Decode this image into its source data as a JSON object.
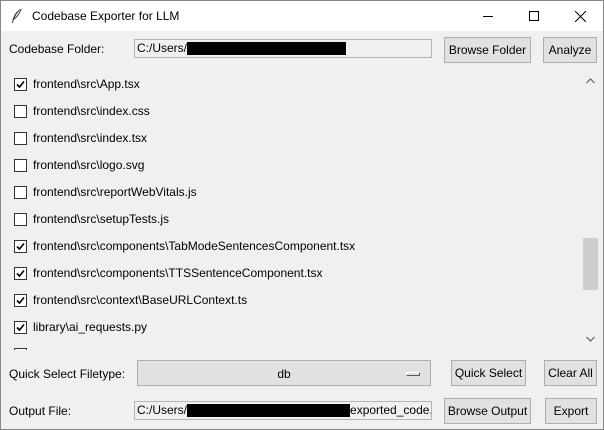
{
  "window": {
    "title": "Codebase Exporter for LLM",
    "controls": {
      "minimize": "minimize",
      "maximize": "maximize",
      "close": "close"
    }
  },
  "codebase": {
    "label": "Codebase Folder:",
    "path_prefix": "C:/Users/",
    "browse_label": "Browse Folder",
    "analyze_label": "Analyze"
  },
  "files": [
    {
      "label": "frontend\\src\\App.tsx",
      "checked": true
    },
    {
      "label": "frontend\\src\\index.css",
      "checked": false
    },
    {
      "label": "frontend\\src\\index.tsx",
      "checked": false
    },
    {
      "label": "frontend\\src\\logo.svg",
      "checked": false
    },
    {
      "label": "frontend\\src\\reportWebVitals.js",
      "checked": false
    },
    {
      "label": "frontend\\src\\setupTests.js",
      "checked": false
    },
    {
      "label": "frontend\\src\\components\\TabModeSentencesComponent.tsx",
      "checked": true
    },
    {
      "label": "frontend\\src\\components\\TTSSentenceComponent.tsx",
      "checked": true
    },
    {
      "label": "frontend\\src\\context\\BaseURLContext.ts",
      "checked": true
    },
    {
      "label": "library\\ai_requests.py",
      "checked": true
    }
  ],
  "quick_select": {
    "label": "Quick Select Filetype:",
    "selected": "db",
    "quick_select_label": "Quick Select",
    "clear_all_label": "Clear All"
  },
  "output": {
    "label": "Output File:",
    "path_prefix": "C:/Users/",
    "path_suffix": "exported_code.t",
    "browse_label": "Browse Output",
    "export_label": "Export"
  },
  "colors": {
    "window_bg": "#f0f0f0",
    "button_bg": "#e1e1e1",
    "button_border": "#adadad",
    "scroll_thumb": "#cdcdcd",
    "redaction": "#000000"
  }
}
